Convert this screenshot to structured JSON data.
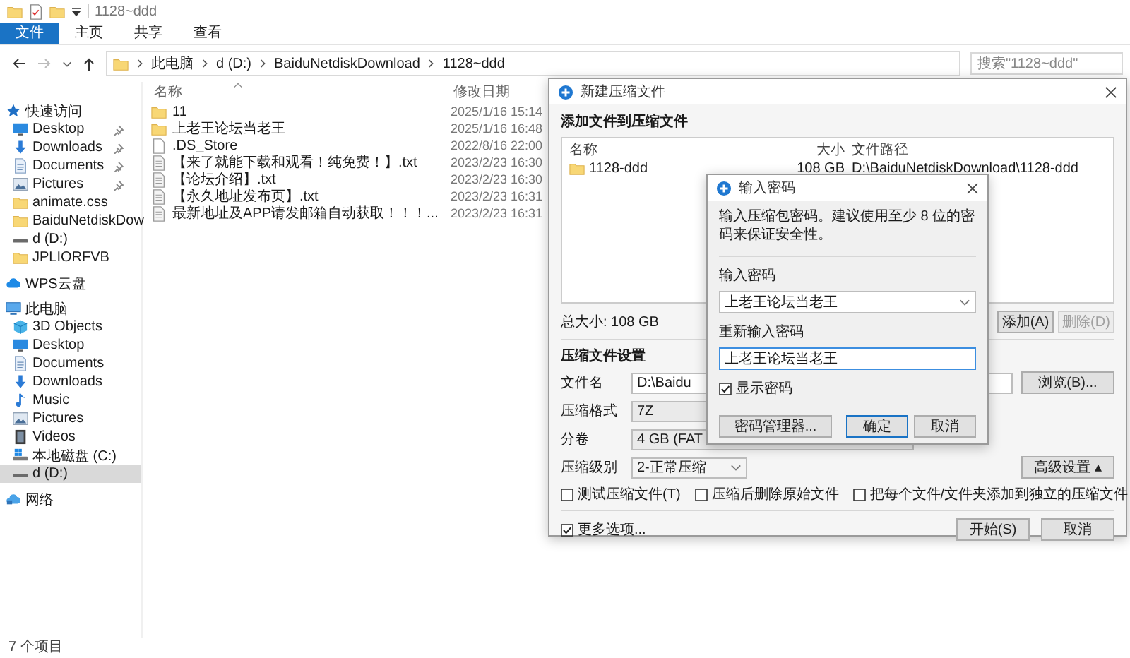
{
  "explorer": {
    "title": "1128~ddd",
    "ribbon_tabs": [
      {
        "label": "文件",
        "selected": true
      },
      {
        "label": "主页",
        "selected": false
      },
      {
        "label": "共享",
        "selected": false
      },
      {
        "label": "查看",
        "selected": false
      }
    ],
    "breadcrumb": [
      "此电脑",
      "d (D:)",
      "BaiduNetdiskDownload",
      "1128~ddd"
    ],
    "search": {
      "placeholder": "搜索\"1128~ddd\""
    },
    "sidebar": [
      {
        "label": "快速访问",
        "kind": "star",
        "selected": false,
        "children": [
          {
            "label": "Desktop",
            "kind": "desktop",
            "pinned": true,
            "selected": false
          },
          {
            "label": "Downloads",
            "kind": "downloads",
            "pinned": true,
            "selected": false
          },
          {
            "label": "Documents",
            "kind": "documents",
            "pinned": true,
            "selected": false
          },
          {
            "label": "Pictures",
            "kind": "pictures",
            "pinned": true,
            "selected": false
          },
          {
            "label": "animate.css",
            "kind": "folder",
            "pinned": false,
            "selected": false
          },
          {
            "label": "BaiduNetdiskDow",
            "kind": "folder",
            "pinned": false,
            "selected": false
          },
          {
            "label": "d (D:)",
            "kind": "drive",
            "pinned": false,
            "selected": false
          },
          {
            "label": "JPLIORFVB",
            "kind": "folder",
            "pinned": false,
            "selected": false
          }
        ]
      },
      {
        "label": "WPS云盘",
        "kind": "cloud",
        "selected": false
      },
      {
        "label": "此电脑",
        "kind": "computer",
        "selected": false,
        "children": [
          {
            "label": "3D Objects",
            "kind": "cube",
            "selected": false
          },
          {
            "label": "Desktop",
            "kind": "desktop",
            "selected": false
          },
          {
            "label": "Documents",
            "kind": "documents",
            "selected": false
          },
          {
            "label": "Downloads",
            "kind": "downloads",
            "selected": false
          },
          {
            "label": "Music",
            "kind": "music",
            "selected": false
          },
          {
            "label": "Pictures",
            "kind": "pictures",
            "selected": false
          },
          {
            "label": "Videos",
            "kind": "videos",
            "selected": false
          },
          {
            "label": "本地磁盘 (C:)",
            "kind": "system_drive",
            "selected": false
          },
          {
            "label": "d (D:)",
            "kind": "drive",
            "selected": true
          }
        ]
      },
      {
        "label": "网络",
        "kind": "network",
        "selected": false
      }
    ],
    "columns": [
      "名称",
      "修改日期"
    ],
    "files": [
      {
        "kind": "folder",
        "name": "11",
        "modified": "2025/1/16 15:14"
      },
      {
        "kind": "folder",
        "name": "上老王论坛当老王",
        "modified": "2025/1/16 16:48"
      },
      {
        "kind": "file",
        "name": ".DS_Store",
        "modified": "2022/8/16 22:00"
      },
      {
        "kind": "text",
        "name": "【来了就能下载和观看！纯免费！】.txt",
        "modified": "2023/2/23 16:30"
      },
      {
        "kind": "text",
        "name": "【论坛介绍】.txt",
        "modified": "2023/2/23 16:30"
      },
      {
        "kind": "text",
        "name": "【永久地址发布页】.txt",
        "modified": "2023/2/23 16:31"
      },
      {
        "kind": "text",
        "name": "最新地址及APP请发邮箱自动获取！！！...",
        "modified": "2023/2/23 16:31"
      }
    ],
    "status_bar": "7 个项目"
  },
  "archive_dialog": {
    "title": "新建压缩文件",
    "files_heading": "添加文件到压缩文件",
    "columns": [
      "名称",
      "大小",
      "文件路径"
    ],
    "rows": [
      {
        "kind": "folder",
        "name": "1128-ddd",
        "size": "108 GB",
        "path": "D:\\BaiduNetdiskDownload\\1128-ddd"
      }
    ],
    "total": "总大小: 108 GB",
    "list_buttons": [
      {
        "label": "添加(A)",
        "disabled": false
      },
      {
        "label": "删除(D)",
        "disabled": true
      }
    ],
    "settings_heading": "压缩文件设置",
    "settings": [
      {
        "label": "文件名",
        "kind": "input",
        "value": "D:\\Baidu",
        "action": "浏览(B)..."
      },
      {
        "label": "压缩格式",
        "kind": "combo",
        "value": "7Z"
      },
      {
        "label": "分卷",
        "kind": "combo",
        "value": "4 GB (FAT"
      },
      {
        "label": "压缩级别",
        "kind": "dropdown",
        "value": "2-正常压缩",
        "action": "高级设置 ▴"
      }
    ],
    "options": [
      {
        "label": "测试压缩文件(T)",
        "checked": false
      },
      {
        "label": "压缩后删除原始文件",
        "checked": false
      },
      {
        "label": "把每个文件/文件夹添加到独立的压缩文件",
        "checked": false
      }
    ],
    "more_options": {
      "label": "更多选项...",
      "checked": true
    },
    "buttons": [
      "开始(S)",
      "取消"
    ]
  },
  "password_dialog": {
    "title": "输入密码",
    "message": "输入压缩包密码。建议使用至少 8 位的密码来保证安全性。",
    "fields": [
      {
        "label": "输入密码",
        "kind": "dropdown",
        "value": "上老王论坛当老王",
        "focused": false
      },
      {
        "label": "重新输入密码",
        "kind": "input",
        "value": "上老王论坛当老王",
        "focused": true
      }
    ],
    "show_password": {
      "label": "显示密码",
      "checked": true
    },
    "buttons": [
      {
        "label": "密码管理器...",
        "default": false,
        "wide": true
      },
      {
        "label": "确定",
        "default": true,
        "wide": false
      },
      {
        "label": "取消",
        "default": false,
        "wide": false
      }
    ]
  }
}
